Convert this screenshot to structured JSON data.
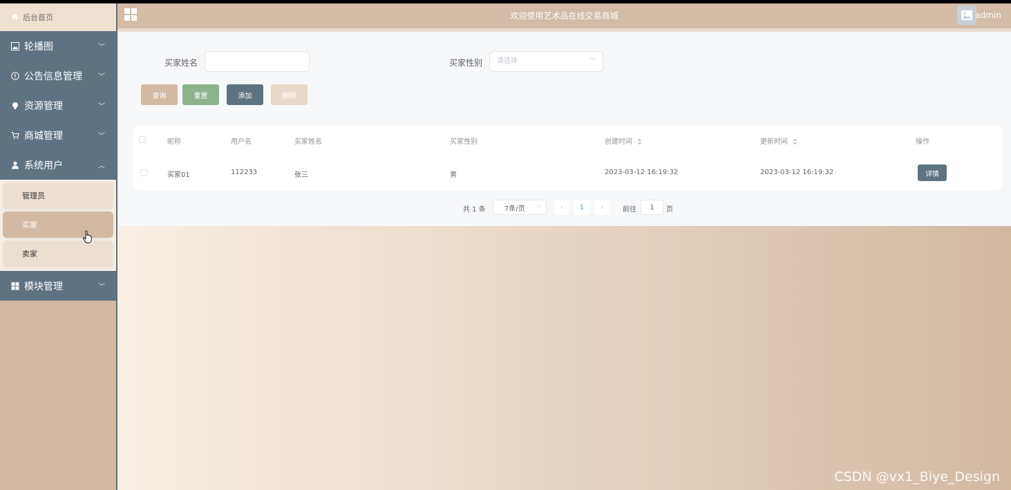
{
  "app": {
    "header_title": "欢迎使用艺术品在线交易商城",
    "username": "admin"
  },
  "sidebar": {
    "home_label": "后台首页",
    "groups": [
      {
        "label": "轮播图",
        "icon": "image-icon",
        "expanded": false
      },
      {
        "label": "公告信息管理",
        "icon": "info-circle-icon",
        "expanded": false
      },
      {
        "label": "资源管理",
        "icon": "bulb-icon",
        "expanded": false
      },
      {
        "label": "商城管理",
        "icon": "cart-icon",
        "expanded": false
      },
      {
        "label": "系统用户",
        "icon": "user-icon",
        "expanded": true
      },
      {
        "label": "模块管理",
        "icon": "grid-icon",
        "expanded": false
      }
    ],
    "submenu": [
      {
        "label": "管理员",
        "active": false
      },
      {
        "label": "买家",
        "active": true
      },
      {
        "label": "卖家",
        "active": false
      }
    ]
  },
  "search": {
    "name_label": "买家姓名",
    "name_value": "",
    "gender_label": "买家性别",
    "gender_placeholder": "请选择"
  },
  "toolbar": {
    "query_label": "查询",
    "reset_label": "重置",
    "add_label": "添加",
    "delete_label": "删除"
  },
  "table": {
    "headers": [
      "昵称",
      "用户名",
      "买家姓名",
      "买家性别",
      "创建时间",
      "更新时间",
      "操作"
    ],
    "rows": [
      {
        "nickname": "买家01",
        "username": "112233",
        "name": "张三",
        "gender": "男",
        "created": "2023-03-12 16:19:32",
        "updated": "2023-03-12 16:19:32",
        "action": "详情"
      }
    ]
  },
  "pagination": {
    "total_text": "共 1 条",
    "page_size": "7条/页",
    "current_page": "1",
    "goto_label": "前往",
    "goto_value": "1",
    "page_suffix": "页"
  },
  "watermark": "CSDN @vx1_Biye_Design",
  "colors": {
    "sidebar_dark": "#5d7382",
    "accent_tan": "#d3b9a2",
    "reset_green": "#8cb38b",
    "add_slate": "#5d7382",
    "delete_disabled": "#e8d9c9"
  }
}
